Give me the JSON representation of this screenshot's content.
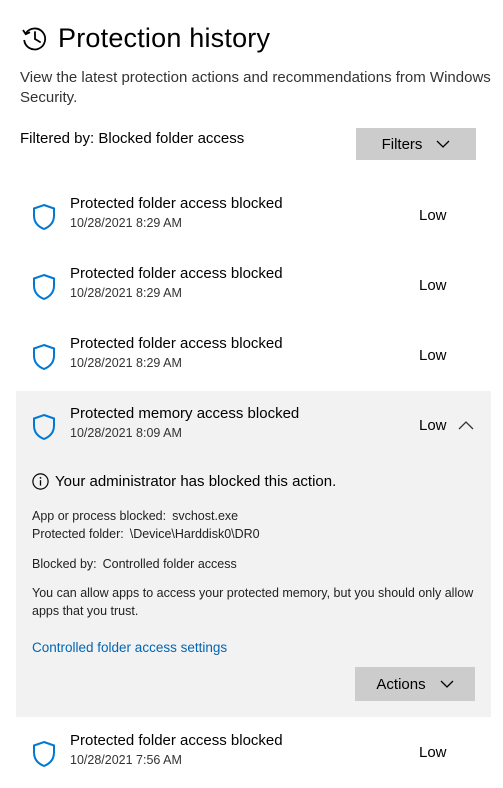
{
  "page": {
    "title": "Protection history",
    "description": "View the latest protection actions and recommendations from Windows Security.",
    "filtered_by": "Filtered by: Blocked folder access",
    "filters_button": "Filters"
  },
  "colors": {
    "accent": "#0066b4",
    "shield": "#0078d4",
    "button_bg": "#cccccc",
    "expanded_bg": "#f2f2f2"
  },
  "items": [
    {
      "title": "Protected folder access blocked",
      "date": "10/28/2021 8:29 AM",
      "severity": "Low",
      "icon": "shield-icon"
    },
    {
      "title": "Protected folder access blocked",
      "date": "10/28/2021 8:29 AM",
      "severity": "Low",
      "icon": "shield-icon"
    },
    {
      "title": "Protected folder access blocked",
      "date": "10/28/2021 8:29 AM",
      "severity": "Low",
      "icon": "shield-icon"
    },
    {
      "title": "Protected memory access blocked",
      "date": "10/28/2021 8:09 AM",
      "severity": "Low",
      "icon": "shield-icon",
      "expanded": true,
      "details": {
        "admin_note": "Your administrator has blocked this action.",
        "app_label": "App or process blocked:",
        "app_value": "svchost.exe",
        "folder_label": "Protected folder:",
        "folder_value": "\\Device\\Harddisk0\\DR0",
        "blocked_by_label": "Blocked by:",
        "blocked_by_value": "Controlled folder access",
        "note": "You can allow apps to access your protected memory, but you should only allow apps that you trust.",
        "link": "Controlled folder access settings",
        "actions_button": "Actions"
      }
    },
    {
      "title": "Protected folder access blocked",
      "date": "10/28/2021 7:56 AM",
      "severity": "Low",
      "icon": "shield-icon"
    }
  ]
}
